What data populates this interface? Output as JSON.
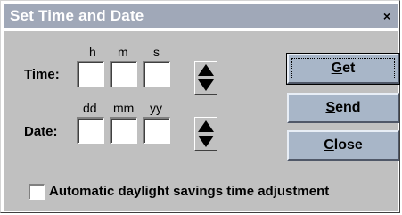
{
  "window": {
    "title": "Set Time and Date",
    "close_glyph": "×"
  },
  "time": {
    "label": "Time:",
    "headers": [
      "h",
      "m",
      "s"
    ],
    "values": [
      "",
      "",
      ""
    ]
  },
  "date": {
    "label": "Date:",
    "headers": [
      "dd",
      "mm",
      "yy"
    ],
    "values": [
      "",
      "",
      ""
    ]
  },
  "buttons": {
    "get": {
      "key": "G",
      "rest": "et"
    },
    "send": {
      "key": "S",
      "rest": "end"
    },
    "close": {
      "key": "C",
      "rest": "lose"
    }
  },
  "options": {
    "dst_label": "Automatic daylight savings time adjustment",
    "dst_checked": false
  },
  "colors": {
    "titlebar": "#a0a8b8",
    "client": "#c0c0c0",
    "button": "#a8b6c8"
  }
}
